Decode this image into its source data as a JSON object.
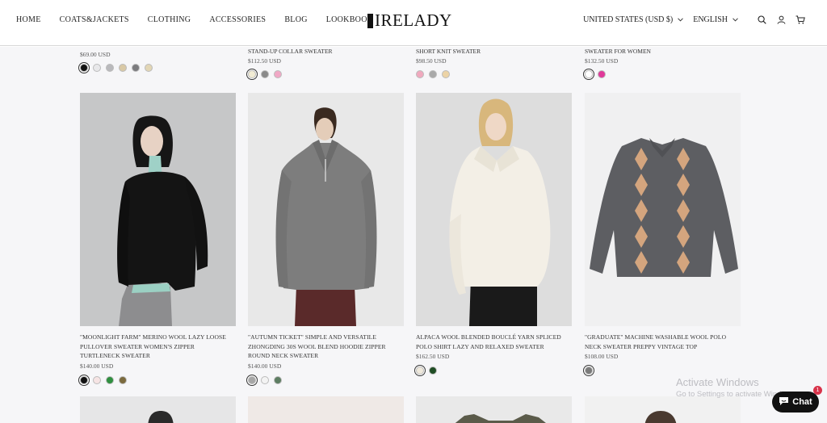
{
  "header": {
    "nav": [
      "HOME",
      "COATS&JACKETS",
      "CLOTHING",
      "ACCESSORIES",
      "BLOG",
      "LOOKBOOK"
    ],
    "logo": "IRELADY",
    "country": "UNITED STATES (USD $)",
    "language": "ENGLISH",
    "icons": [
      "search-icon",
      "account-icon",
      "cart-icon"
    ]
  },
  "top_row": [
    {
      "title": "",
      "price": "$69.00 USD",
      "swatches": [
        "#111111",
        "#e8e8ea",
        "#b9b9bc",
        "#d9c9a6",
        "#7b7b7e",
        "#e2d6b5"
      ]
    },
    {
      "title": "STAND-UP COLLAR SWEATER",
      "price": "$112.50 USD",
      "swatches": [
        "#f2ecd4",
        "#8a8a8a",
        "#f1a8c6"
      ]
    },
    {
      "title": "SHORT KNIT SWEATER",
      "price": "$98.50 USD",
      "swatches": [
        "#f0a9be",
        "#a9a9a9",
        "#ecd3a6"
      ]
    },
    {
      "title": "SWEATER FOR WOMEN",
      "price": "$132.50 USD",
      "swatches": [
        "#ffffff",
        "#e0399a"
      ]
    }
  ],
  "products": [
    {
      "title": "\"MOONLIGHT FARM\" MERINO WOOL LAZY LOOSE PULLOVER SWEATER WOMEN'S ZIPPER TURTLENECK SWEATER",
      "price": "$140.00 USD",
      "swatches": [
        "#111111",
        "#f6e4e4",
        "#2f8f3f",
        "#7b6a3e"
      ]
    },
    {
      "title": "\"AUTUMN TICKET\" SIMPLE AND VERSATILE ZHONGDING 30S WOOL BLEND HOODIE ZIPPER ROUND NECK SWEATER",
      "price": "$140.00 USD",
      "swatches": [
        "#a7a7a7",
        "#f3f3f3",
        "#5d7d62"
      ]
    },
    {
      "title": "ALPACA WOOL BLENDED BOUCLÉ YARN SPLICED POLO SHIRT LAZY AND RELAXED SWEATER",
      "price": "$162.50 USD",
      "swatches": [
        "#efe9dc",
        "#1f4d24"
      ]
    },
    {
      "title": "\"GRADUATE\" MACHINE WASHABLE WOOL POLO NECK SWEATER PREPPY VINTAGE TOP",
      "price": "$108.00 USD",
      "swatches": [
        "#7b7b7b"
      ]
    }
  ],
  "watermark": {
    "line1": "Activate Windows",
    "line2": "Go to Settings to activate Windows."
  },
  "chat": {
    "label": "Chat",
    "badge": "1"
  }
}
